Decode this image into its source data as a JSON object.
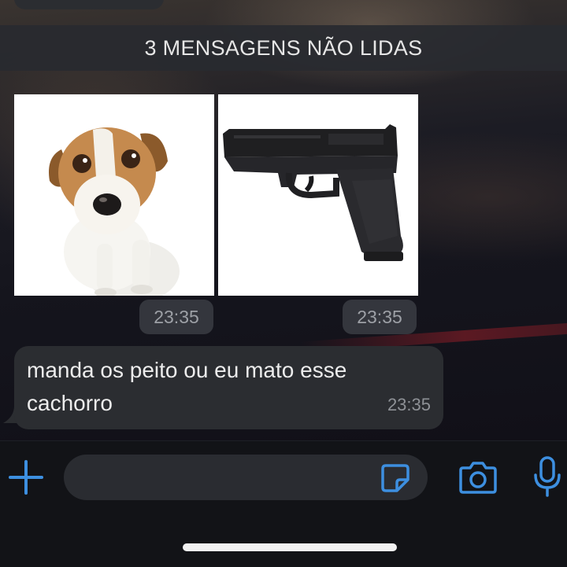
{
  "banner": {
    "unread_label": "3 MENSAGENS NÃO LIDAS"
  },
  "messages": [
    {
      "type": "image",
      "subject": "dog photo",
      "time": "23:35"
    },
    {
      "type": "image",
      "subject": "pistol photo",
      "time": "23:35"
    },
    {
      "type": "text",
      "text": "manda os peito ou eu mato esse cachorro",
      "time": "23:35"
    }
  ],
  "input_bar": {
    "icons": [
      "plus-icon",
      "sticker-icon",
      "camera-icon",
      "microphone-icon"
    ]
  },
  "colors": {
    "accent": "#3d8fe0",
    "bubble": "#2b2d31",
    "banner_bg": "#282a30",
    "background": "#121317"
  }
}
